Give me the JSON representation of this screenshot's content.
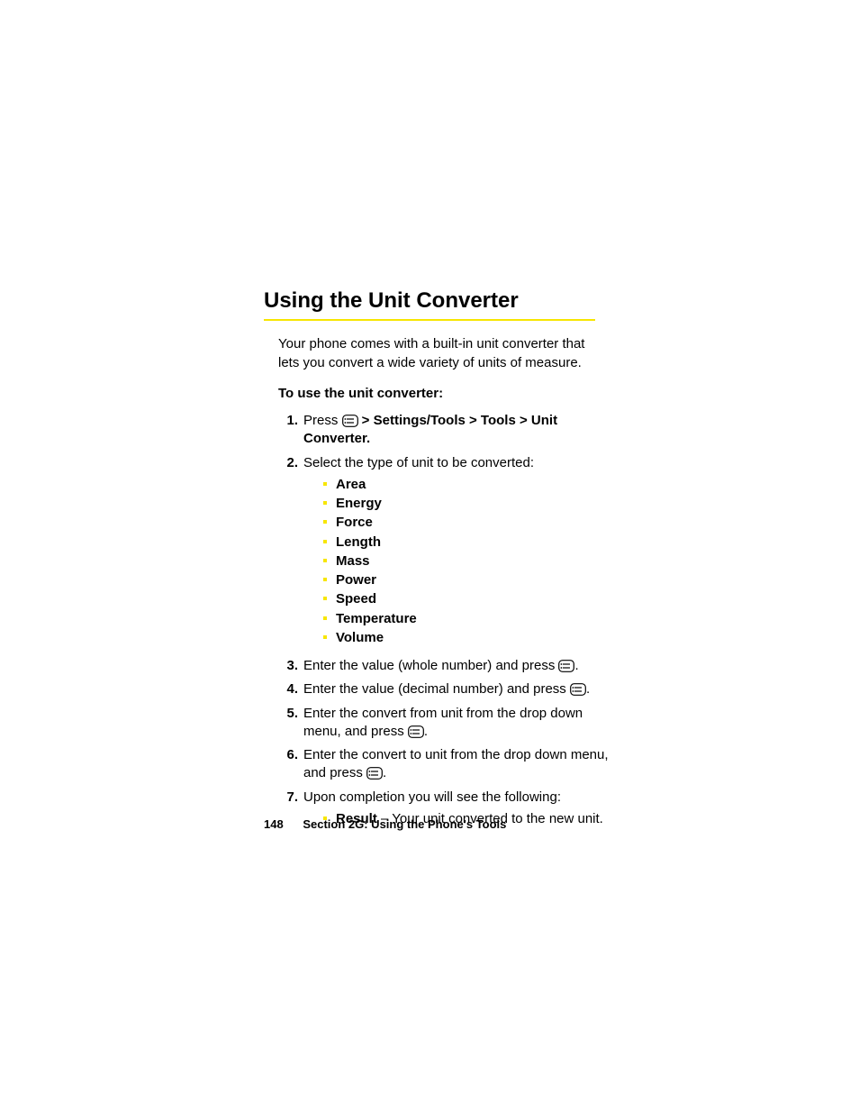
{
  "heading": "Using the Unit Converter",
  "intro": "Your phone comes with a built-in unit converter that lets you convert a wide variety of units of measure.",
  "subhead": "To use the unit converter:",
  "step1": {
    "num": "1.",
    "lead": "Press ",
    "path": " > Settings/Tools > Tools > Unit Converter."
  },
  "step2": {
    "num": "2.",
    "text": "Select the type of unit to be converted:",
    "units": [
      "Area",
      "Energy",
      "Force",
      "Length",
      "Mass",
      "Power",
      "Speed",
      "Temperature",
      "Volume"
    ]
  },
  "step3": {
    "num": "3.",
    "lead": "Enter the value (whole number) and press ",
    "tail": "."
  },
  "step4": {
    "num": "4.",
    "lead": "Enter the value (decimal number) and press ",
    "tail": "."
  },
  "step5": {
    "num": "5.",
    "lead": "Enter the convert from unit from the drop down menu, and press ",
    "tail": "."
  },
  "step6": {
    "num": "6.",
    "lead": "Enter the convert to unit from the drop down menu, and press ",
    "tail": "."
  },
  "step7": {
    "num": "7.",
    "text": "Upon completion you will see the following:",
    "result_label": "Result",
    "result_text": " – Your unit converted to the new unit."
  },
  "footer": {
    "page": "148",
    "section": "Section 2G: Using the Phone's Tools"
  }
}
